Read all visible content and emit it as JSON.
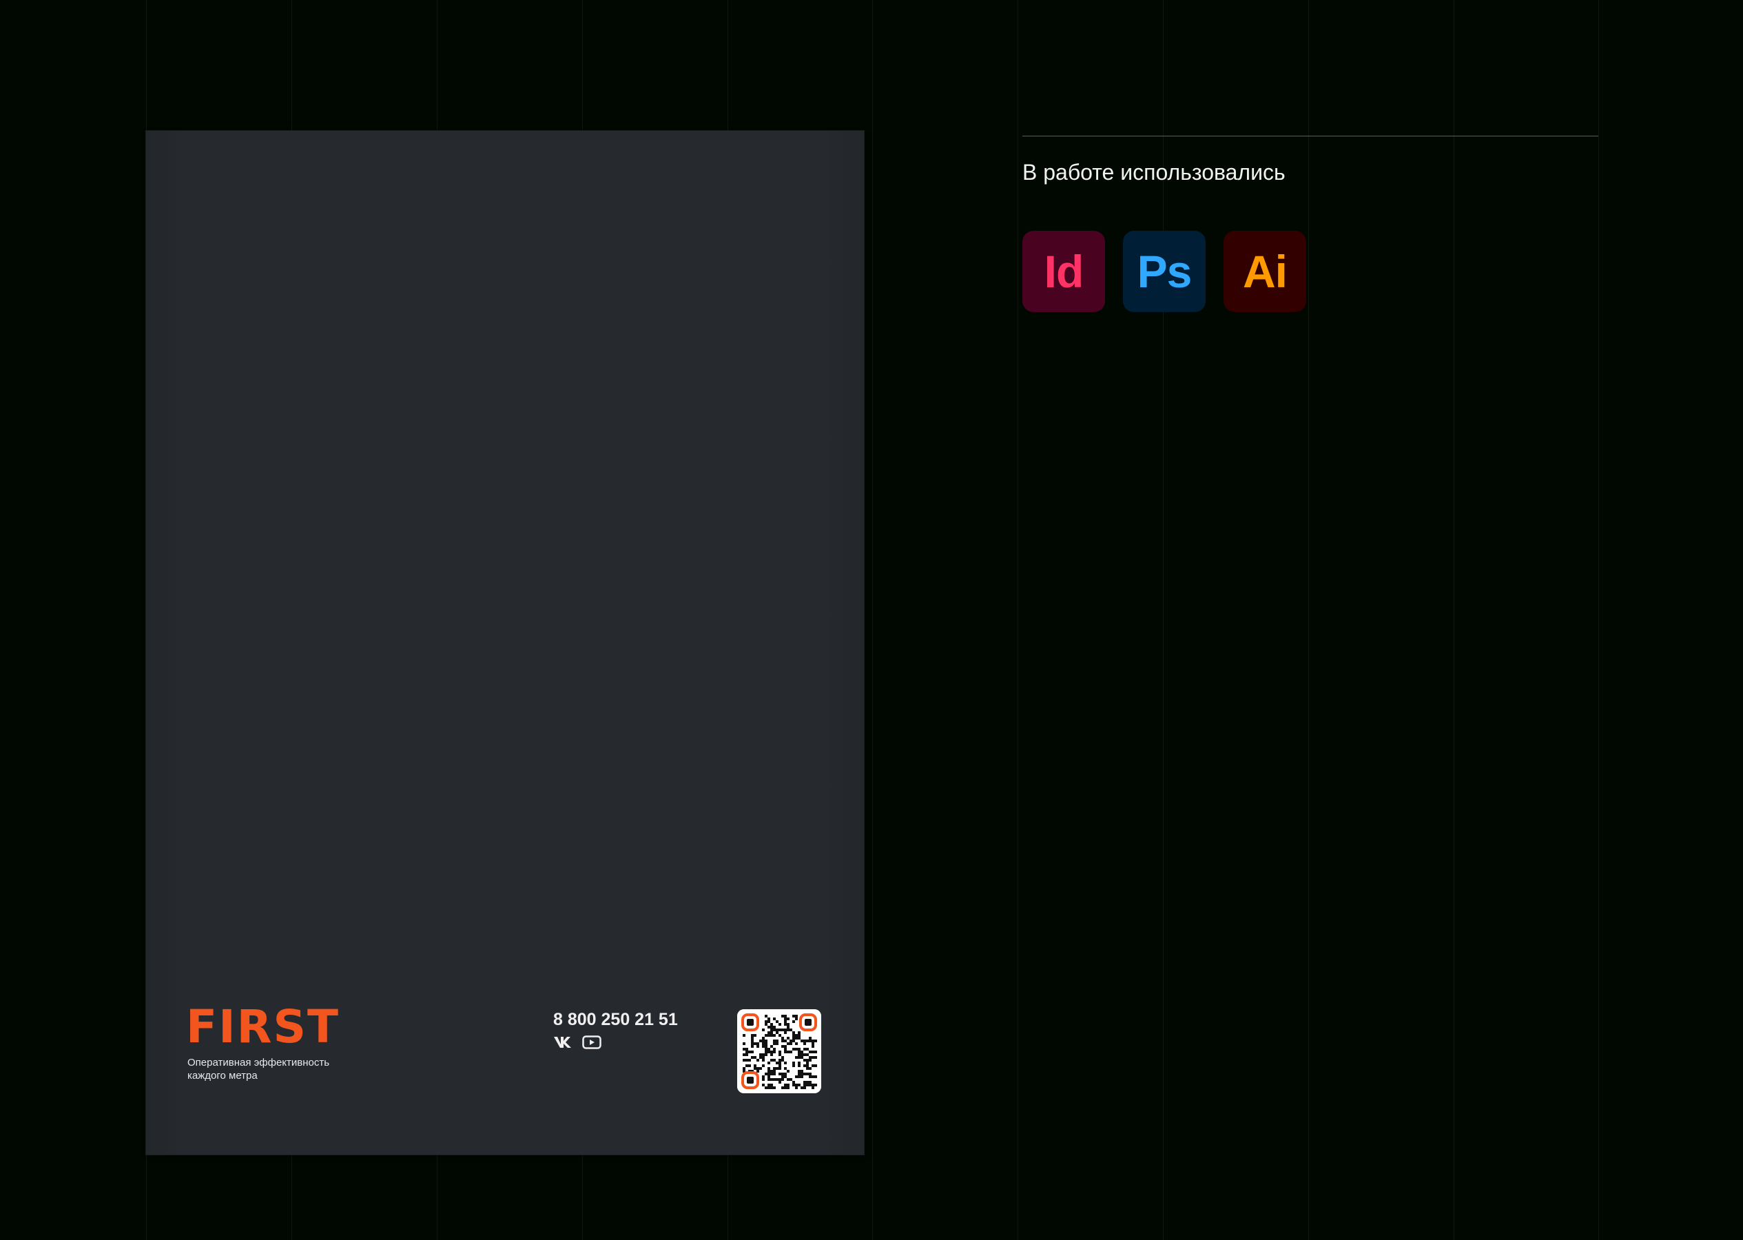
{
  "brochure": {
    "logo_text": "FIRST",
    "tagline_line1": "Оперативная эффективность",
    "tagline_line2": "каждого метра",
    "phone": "8 800 250 21 51",
    "social_icons": [
      "vk-icon",
      "youtube-icon"
    ],
    "qr_icon": "qr-code-icon",
    "colors": {
      "cover": "#262a2e",
      "brand_orange": "#f2561e"
    }
  },
  "tools_section": {
    "title": "В работе использовались",
    "apps": [
      {
        "label": "Id",
        "icon": "indesign-icon",
        "bg": "#49021f",
        "fg": "#ff3366"
      },
      {
        "label": "Ps",
        "icon": "photoshop-icon",
        "bg": "#001e36",
        "fg": "#31a8ff"
      },
      {
        "label": "Ai",
        "icon": "illustrator-icon",
        "bg": "#330000",
        "fg": "#ff9a00"
      }
    ]
  },
  "colors": {
    "background": "#010801"
  }
}
